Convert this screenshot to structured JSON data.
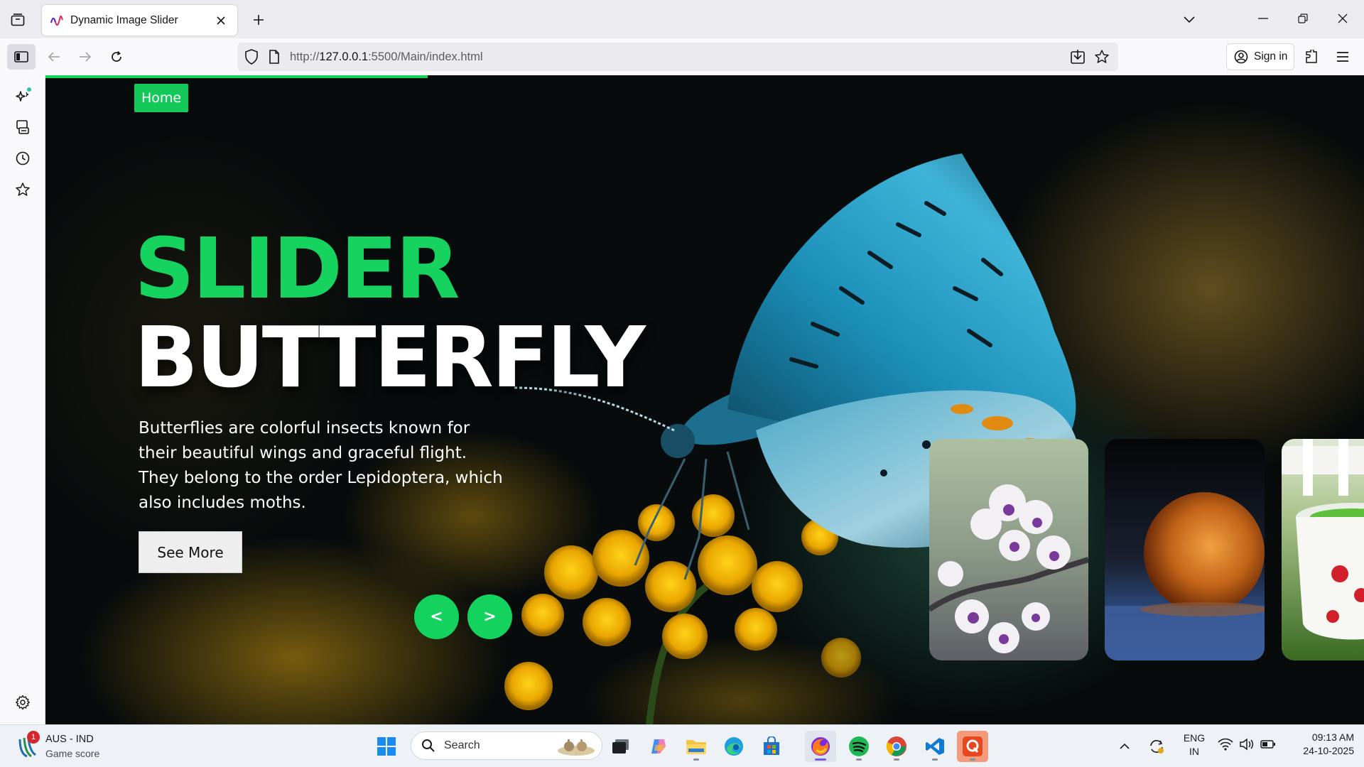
{
  "browser": {
    "tab": {
      "title": "Dynamic Image Slider",
      "icon": "site-favicon"
    },
    "url": {
      "prefix": "http://",
      "host": "127.0.0.1",
      "rest": ":5500/Main/index.html"
    },
    "sign_in_label": "Sign in",
    "icons": [
      "tab-list-icon",
      "new-tab-icon",
      "list-all-tabs-icon",
      "minimize-icon",
      "restore-icon",
      "close-icon",
      "sidebar-icon",
      "back-icon",
      "forward-icon",
      "reload-icon",
      "shield-icon",
      "page-icon",
      "download-icon",
      "star-icon",
      "account-icon",
      "extensions-icon",
      "menu-icon"
    ]
  },
  "sidebar": {
    "icons": [
      "ai-chatbot-icon",
      "synced-tabs-icon",
      "history-icon",
      "bookmarks-icon",
      "settings-icon"
    ]
  },
  "page": {
    "home_label": "Home",
    "progress_fraction": 0.29,
    "title": "SLIDER",
    "topic": "BUTTERFLY",
    "description": "Butterflies are colorful insects known for their beautiful wings and graceful flight. They belong to the order Lepidoptera, which also includes moths.",
    "see_more_label": "See More",
    "prev_label": "<",
    "next_label": ">",
    "thumbnails": [
      "flowers",
      "frozen-bubble",
      "cup-on-grass"
    ],
    "accent_color": "#14d25e"
  },
  "taskbar": {
    "widget_title": "AUS - IND",
    "widget_subtitle": "Game score",
    "widget_badge": "1",
    "search_placeholder": "Search",
    "apps": [
      "start",
      "search",
      "task-view",
      "copilot",
      "file-explorer",
      "edge",
      "store",
      "firefox",
      "spotify",
      "chrome",
      "vscode",
      "qa-app"
    ],
    "language_top": "ENG",
    "language_bottom": "IN",
    "time": "09:13 AM",
    "date": "24-10-2025"
  }
}
